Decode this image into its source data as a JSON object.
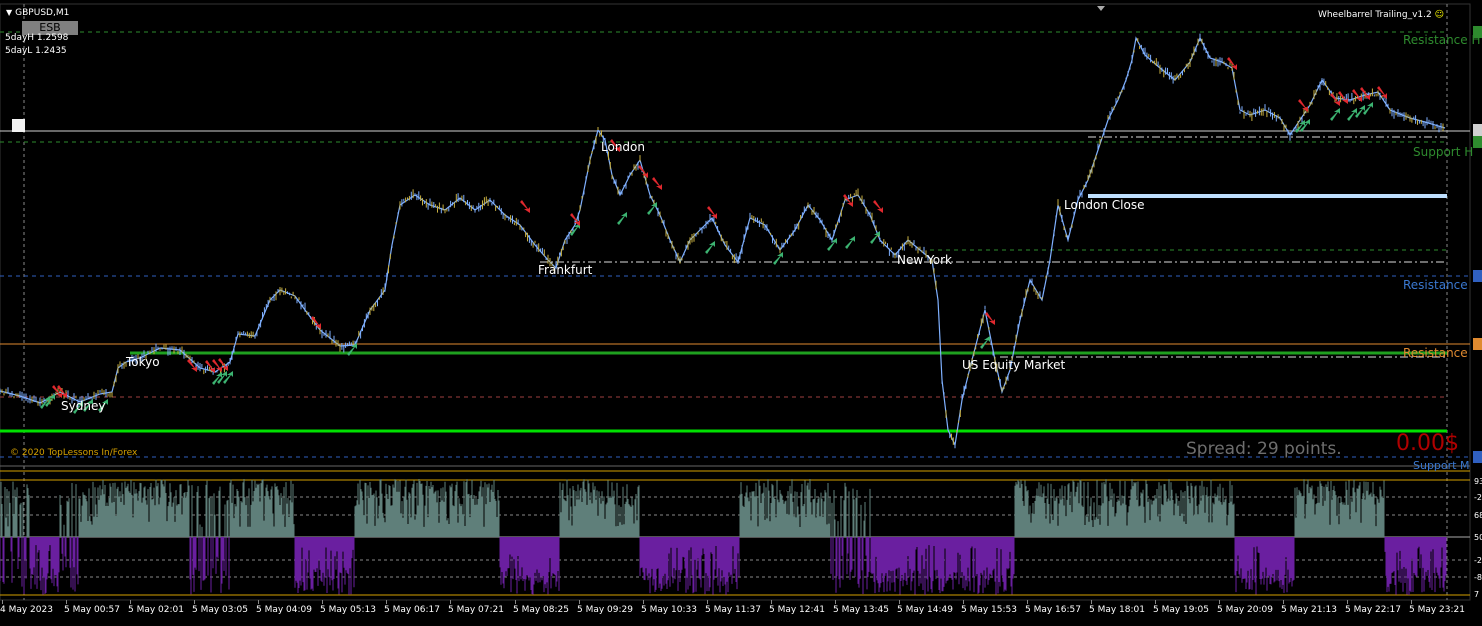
{
  "header": {
    "symbol": "GBPUSD,M1",
    "esb_button": "ESB",
    "five_day_high": "5dayH 1.2598",
    "five_day_low": "5dayL 1.2435",
    "ea_name": "Wheelbarrel Trailing_v1.2",
    "ea_face": "☺"
  },
  "sessions": {
    "sydney": "Sydney",
    "tokyo": "Tokyo",
    "frankfurt": "Frankfurt",
    "london": "London",
    "new_york": "New York",
    "us_equity": "US Equity Market",
    "london_close": "London Close"
  },
  "zones": {
    "resistance_h": "Resistance H",
    "support_h": "Support H",
    "resistance_blue": "Resistance",
    "resistance_orange": "Resistance",
    "support_m": "Support M"
  },
  "footer": {
    "copyright": "© 2020 TopLessons In/Forex",
    "spread": "Spread: 29 points.",
    "profit": "0.00$"
  },
  "time_axis": [
    "4 May 2023",
    "5 May 00:57",
    "5 May 02:01",
    "5 May 03:05",
    "5 May 04:09",
    "5 May 05:13",
    "5 May 06:17",
    "5 May 07:21",
    "5 May 08:25",
    "5 May 09:29",
    "5 May 10:33",
    "5 May 11:37",
    "5 May 12:41",
    "5 May 13:45",
    "5 May 14:49",
    "5 May 15:53",
    "5 May 16:57",
    "5 May 18:01",
    "5 May 19:05",
    "5 May 20:09",
    "5 May 21:13",
    "5 May 22:17",
    "5 May 23:21"
  ],
  "indicator_axis": [
    "93",
    "-2",
    "68",
    "50",
    "-2",
    "-8",
    "7"
  ],
  "colors": {
    "background": "#000000",
    "price_line": "#7fb0ff",
    "bull_arrow": "#3cb371",
    "bear_arrow": "#e0282e",
    "support_green": "#00e000",
    "london_close_line": "#bfe0ff",
    "indicator_upper": "#5f7f7a",
    "indicator_lower": "#6a1fa0"
  }
}
